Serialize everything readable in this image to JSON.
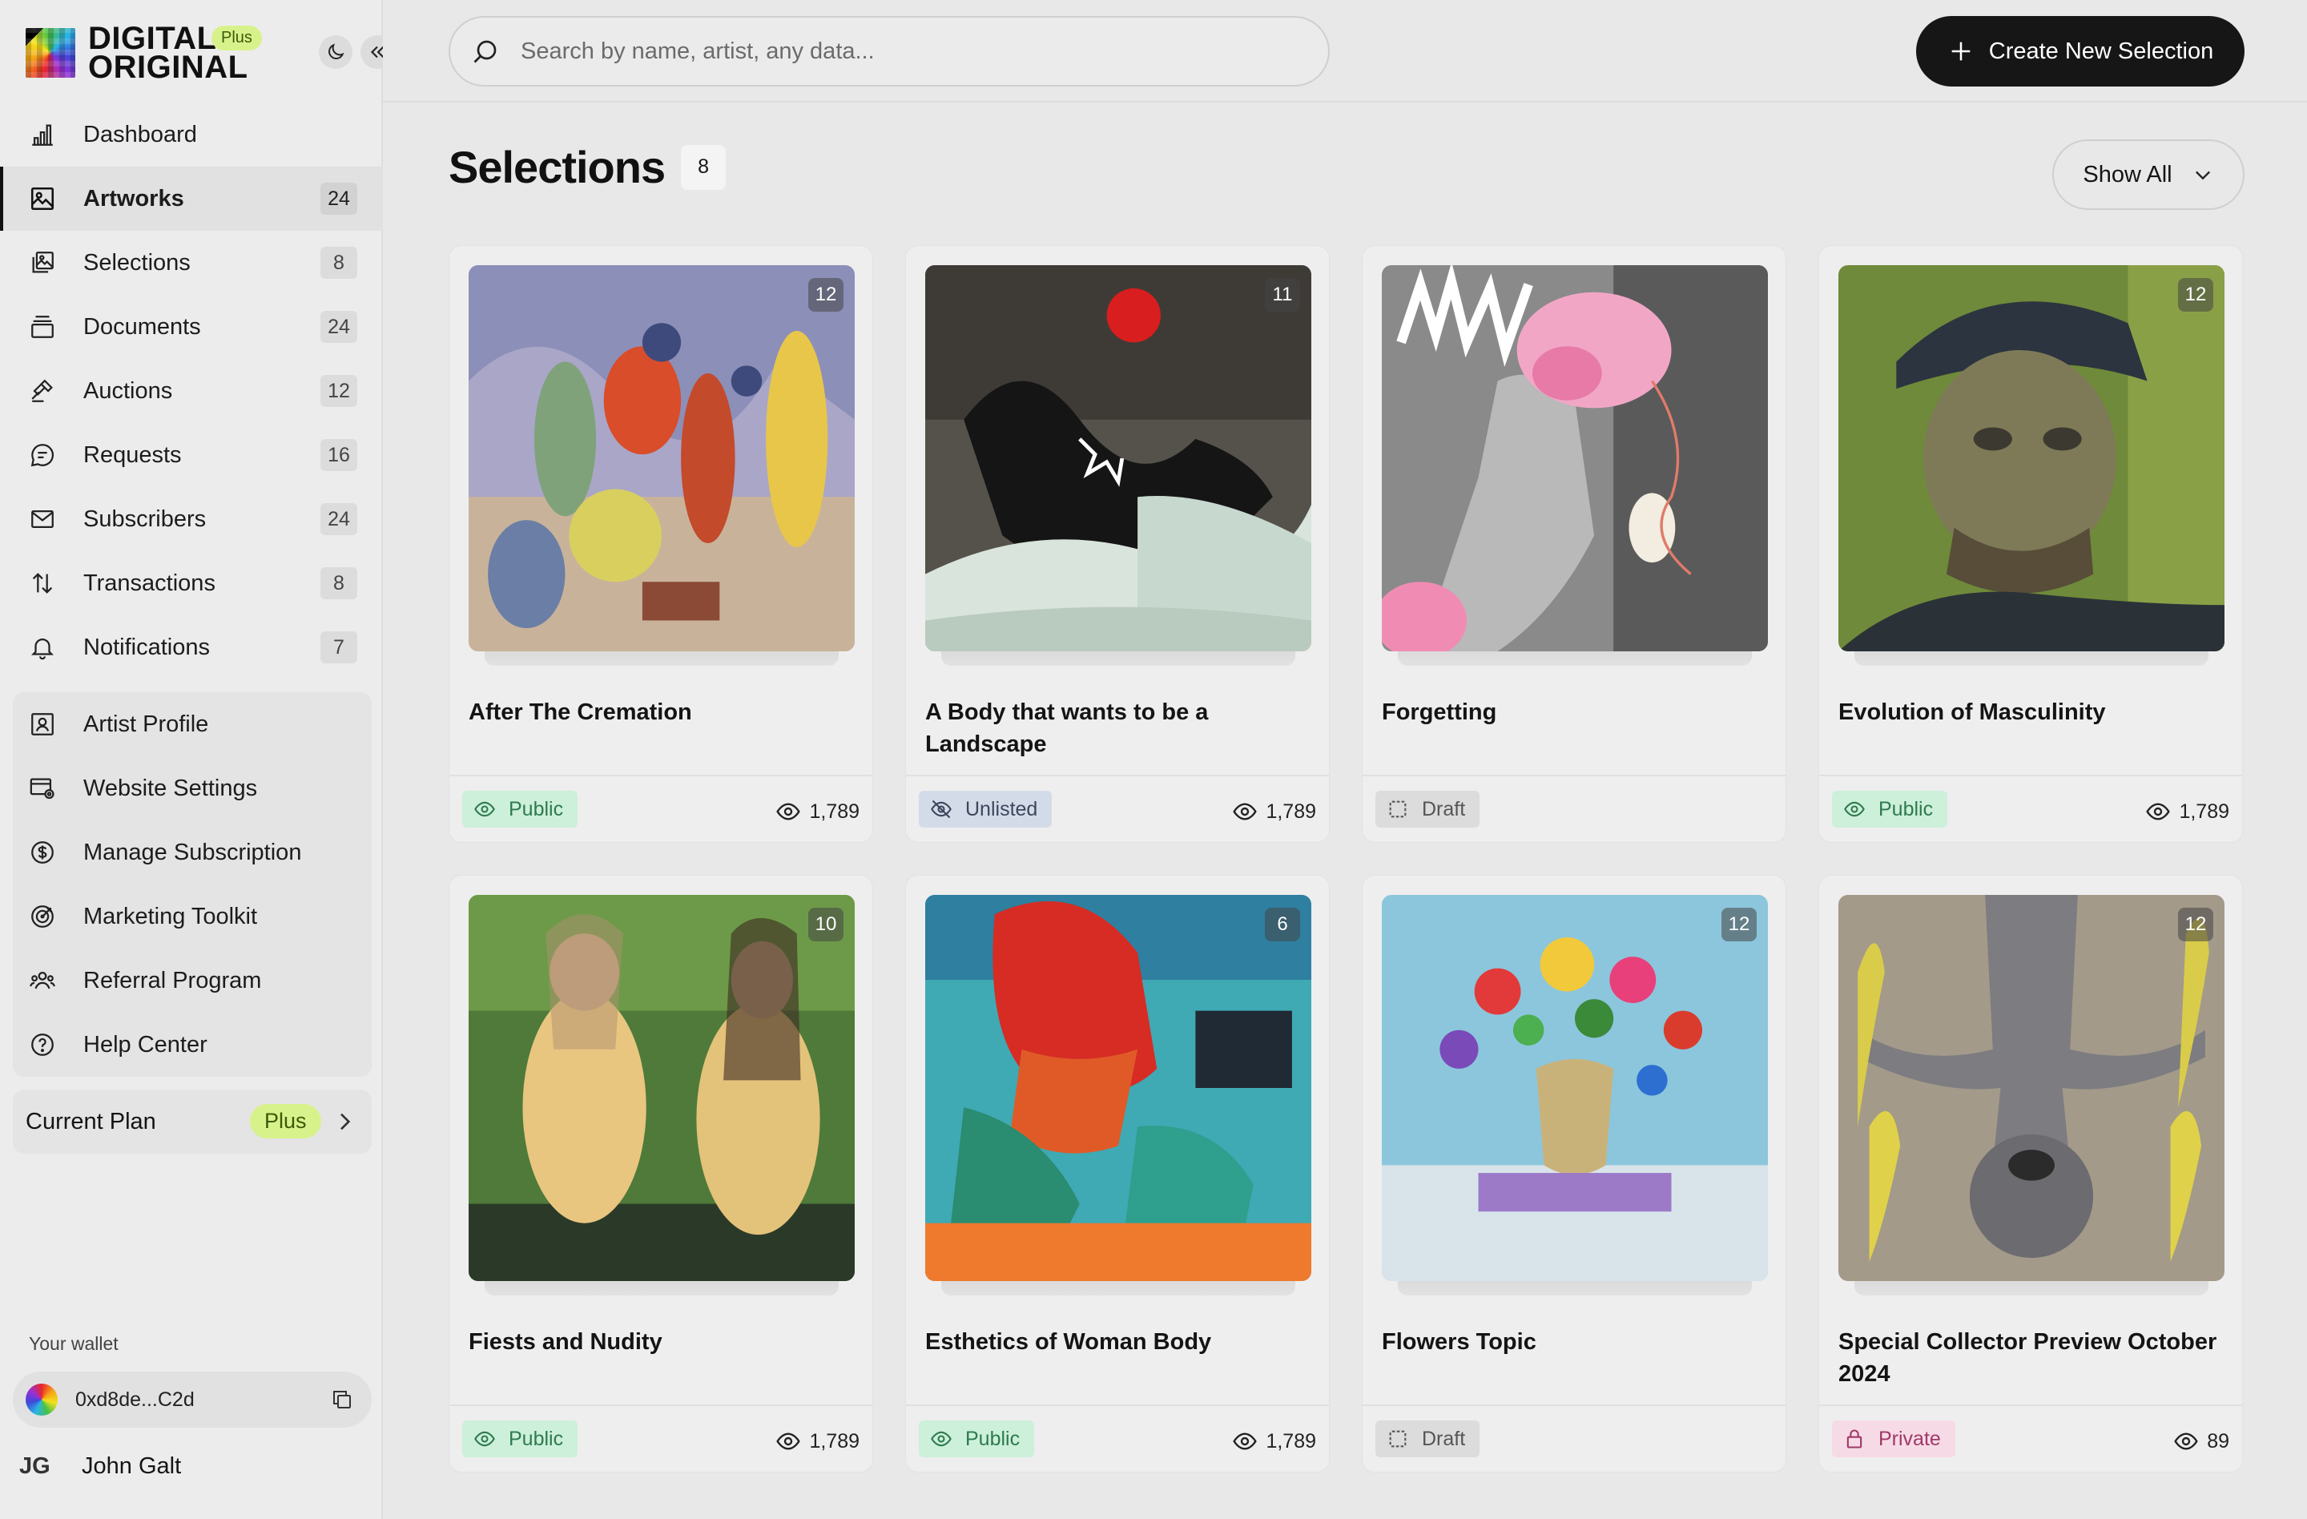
{
  "brand": {
    "line1": "DIGITAL",
    "line2": "ORIGINAL",
    "badge": "Plus"
  },
  "sidebar": {
    "items": [
      {
        "label": "Dashboard",
        "icon": "bar-chart-icon",
        "count": ""
      },
      {
        "label": "Artworks",
        "icon": "image-icon",
        "count": "24",
        "active": true
      },
      {
        "label": "Selections",
        "icon": "stacked-images-icon",
        "count": "8"
      },
      {
        "label": "Documents",
        "icon": "document-stack-icon",
        "count": "24"
      },
      {
        "label": "Auctions",
        "icon": "gavel-icon",
        "count": "12"
      },
      {
        "label": "Requests",
        "icon": "chat-bubble-icon",
        "count": "16"
      },
      {
        "label": "Subscribers",
        "icon": "mail-icon",
        "count": "24"
      },
      {
        "label": "Transactions",
        "icon": "arrows-updown-icon",
        "count": "8"
      },
      {
        "label": "Notifications",
        "icon": "bell-icon",
        "count": "7"
      }
    ],
    "secondary": [
      {
        "label": "Artist Profile",
        "icon": "profile-icon"
      },
      {
        "label": "Website Settings",
        "icon": "website-settings-icon"
      },
      {
        "label": "Manage Subscription",
        "icon": "dollar-circle-icon"
      },
      {
        "label": "Marketing Toolkit",
        "icon": "target-icon"
      },
      {
        "label": "Referral Program",
        "icon": "users-icon"
      },
      {
        "label": "Help Center",
        "icon": "help-icon"
      }
    ],
    "plan": {
      "label": "Current Plan",
      "badge": "Plus"
    },
    "wallet": {
      "label": "Your wallet",
      "address": "0xd8de...C2d"
    },
    "user": {
      "initials": "JG",
      "name": "John Galt"
    }
  },
  "topbar": {
    "search_placeholder": "Search by name, artist, any data...",
    "create_label": "Create New Selection"
  },
  "page": {
    "title": "Selections",
    "count": "8",
    "filter_label": "Show All"
  },
  "cards": [
    {
      "title": "After The Cremation",
      "count": "12",
      "status": "Public",
      "status_type": "public",
      "views": "1,789"
    },
    {
      "title": "A Body that wants to be a Landscape",
      "count": "11",
      "status": "Unlisted",
      "status_type": "unlisted",
      "views": "1,789"
    },
    {
      "title": "Forgetting",
      "count": "",
      "status": "Draft",
      "status_type": "draft",
      "views": ""
    },
    {
      "title": "Evolution of Masculinity",
      "count": "12",
      "status": "Public",
      "status_type": "public",
      "views": "1,789"
    },
    {
      "title": "Fiests and Nudity",
      "count": "10",
      "status": "Public",
      "status_type": "public",
      "views": "1,789"
    },
    {
      "title": "Esthetics of Woman Body",
      "count": "6",
      "status": "Public",
      "status_type": "public",
      "views": "1,789"
    },
    {
      "title": "Flowers Topic",
      "count": "12",
      "status": "Draft",
      "status_type": "draft",
      "views": ""
    },
    {
      "title": "Special Collector Preview October 2024",
      "count": "12",
      "status": "Private",
      "status_type": "private",
      "views": "89"
    }
  ],
  "colors": {
    "accent": "#161616",
    "plus_badge": "#d8f28b",
    "public": "#ccf0da",
    "unlisted": "#d4dbe8",
    "draft": "#dcdcdc",
    "private": "#f6dbe6"
  }
}
